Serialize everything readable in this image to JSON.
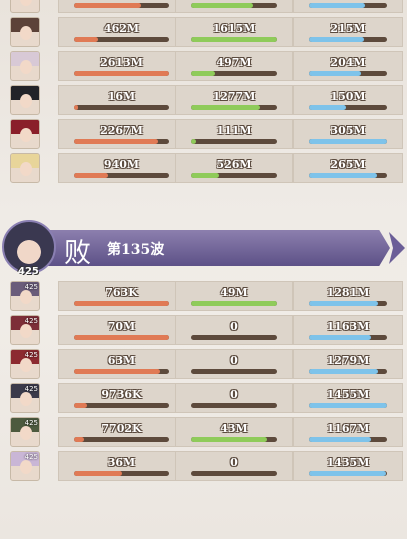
{
  "colors": {
    "damage": "#e07a55",
    "heal": "#8fcb5a",
    "taken": "#7ec3ea",
    "bar_bg": "#5d4a3c",
    "banner": "#6b5e97"
  },
  "top_section": {
    "rows": [
      {
        "level": "",
        "damage": "",
        "heal": "",
        "taken": "",
        "damage_pct": 0.7,
        "heal_pct": 0.72,
        "taken_pct": 0.72,
        "hair": "#c43b4d"
      },
      {
        "level": "",
        "damage": "462M",
        "heal": "1615M",
        "taken": "215M",
        "damage_pct": 0.25,
        "heal_pct": 1.0,
        "taken_pct": 0.7,
        "hair": "#5c4238"
      },
      {
        "level": "",
        "damage": "2613M",
        "heal": "497M",
        "taken": "204M",
        "damage_pct": 1.0,
        "heal_pct": 0.28,
        "taken_pct": 0.67,
        "hair": "#d8c9d6"
      },
      {
        "level": "",
        "damage": "16M",
        "heal": "1277M",
        "taken": "150M",
        "damage_pct": 0.04,
        "heal_pct": 0.8,
        "taken_pct": 0.47,
        "hair": "#222328"
      },
      {
        "level": "",
        "damage": "2267M",
        "heal": "111M",
        "taken": "305M",
        "damage_pct": 0.88,
        "heal_pct": 0.06,
        "taken_pct": 1.0,
        "hair": "#8a1f2a"
      },
      {
        "level": "",
        "damage": "940M",
        "heal": "526M",
        "taken": "265M",
        "damage_pct": 0.36,
        "heal_pct": 0.32,
        "taken_pct": 0.87,
        "hair": "#e8d59a"
      }
    ]
  },
  "banner": {
    "result": "败",
    "wave_label": "第135波",
    "avatar_level": "425"
  },
  "bottom_section": {
    "rows": [
      {
        "level": "425",
        "damage": "763K",
        "heal": "49M",
        "taken": "1281M",
        "damage_pct": 1.0,
        "heal_pct": 1.0,
        "taken_pct": 0.88,
        "hair": "#6a5c7a"
      },
      {
        "level": "425",
        "damage": "70M",
        "heal": "0",
        "taken": "1163M",
        "damage_pct": 1.0,
        "heal_pct": 0.0,
        "taken_pct": 0.8,
        "hair": "#7d2e38"
      },
      {
        "level": "425",
        "damage": "63M",
        "heal": "0",
        "taken": "1279M",
        "damage_pct": 0.9,
        "heal_pct": 0.0,
        "taken_pct": 0.88,
        "hair": "#8c2a30"
      },
      {
        "level": "425",
        "damage": "9736K",
        "heal": "0",
        "taken": "1455M",
        "damage_pct": 0.14,
        "heal_pct": 0.0,
        "taken_pct": 1.0,
        "hair": "#3b3a4a"
      },
      {
        "level": "425",
        "damage": "7702K",
        "heal": "43M",
        "taken": "1167M",
        "damage_pct": 0.11,
        "heal_pct": 0.88,
        "taken_pct": 0.8,
        "hair": "#4d5a3e"
      },
      {
        "level": "425",
        "damage": "36M",
        "heal": "0",
        "taken": "1435M",
        "damage_pct": 0.51,
        "heal_pct": 0.0,
        "taken_pct": 0.99,
        "hair": "#c9b6d6"
      }
    ]
  }
}
